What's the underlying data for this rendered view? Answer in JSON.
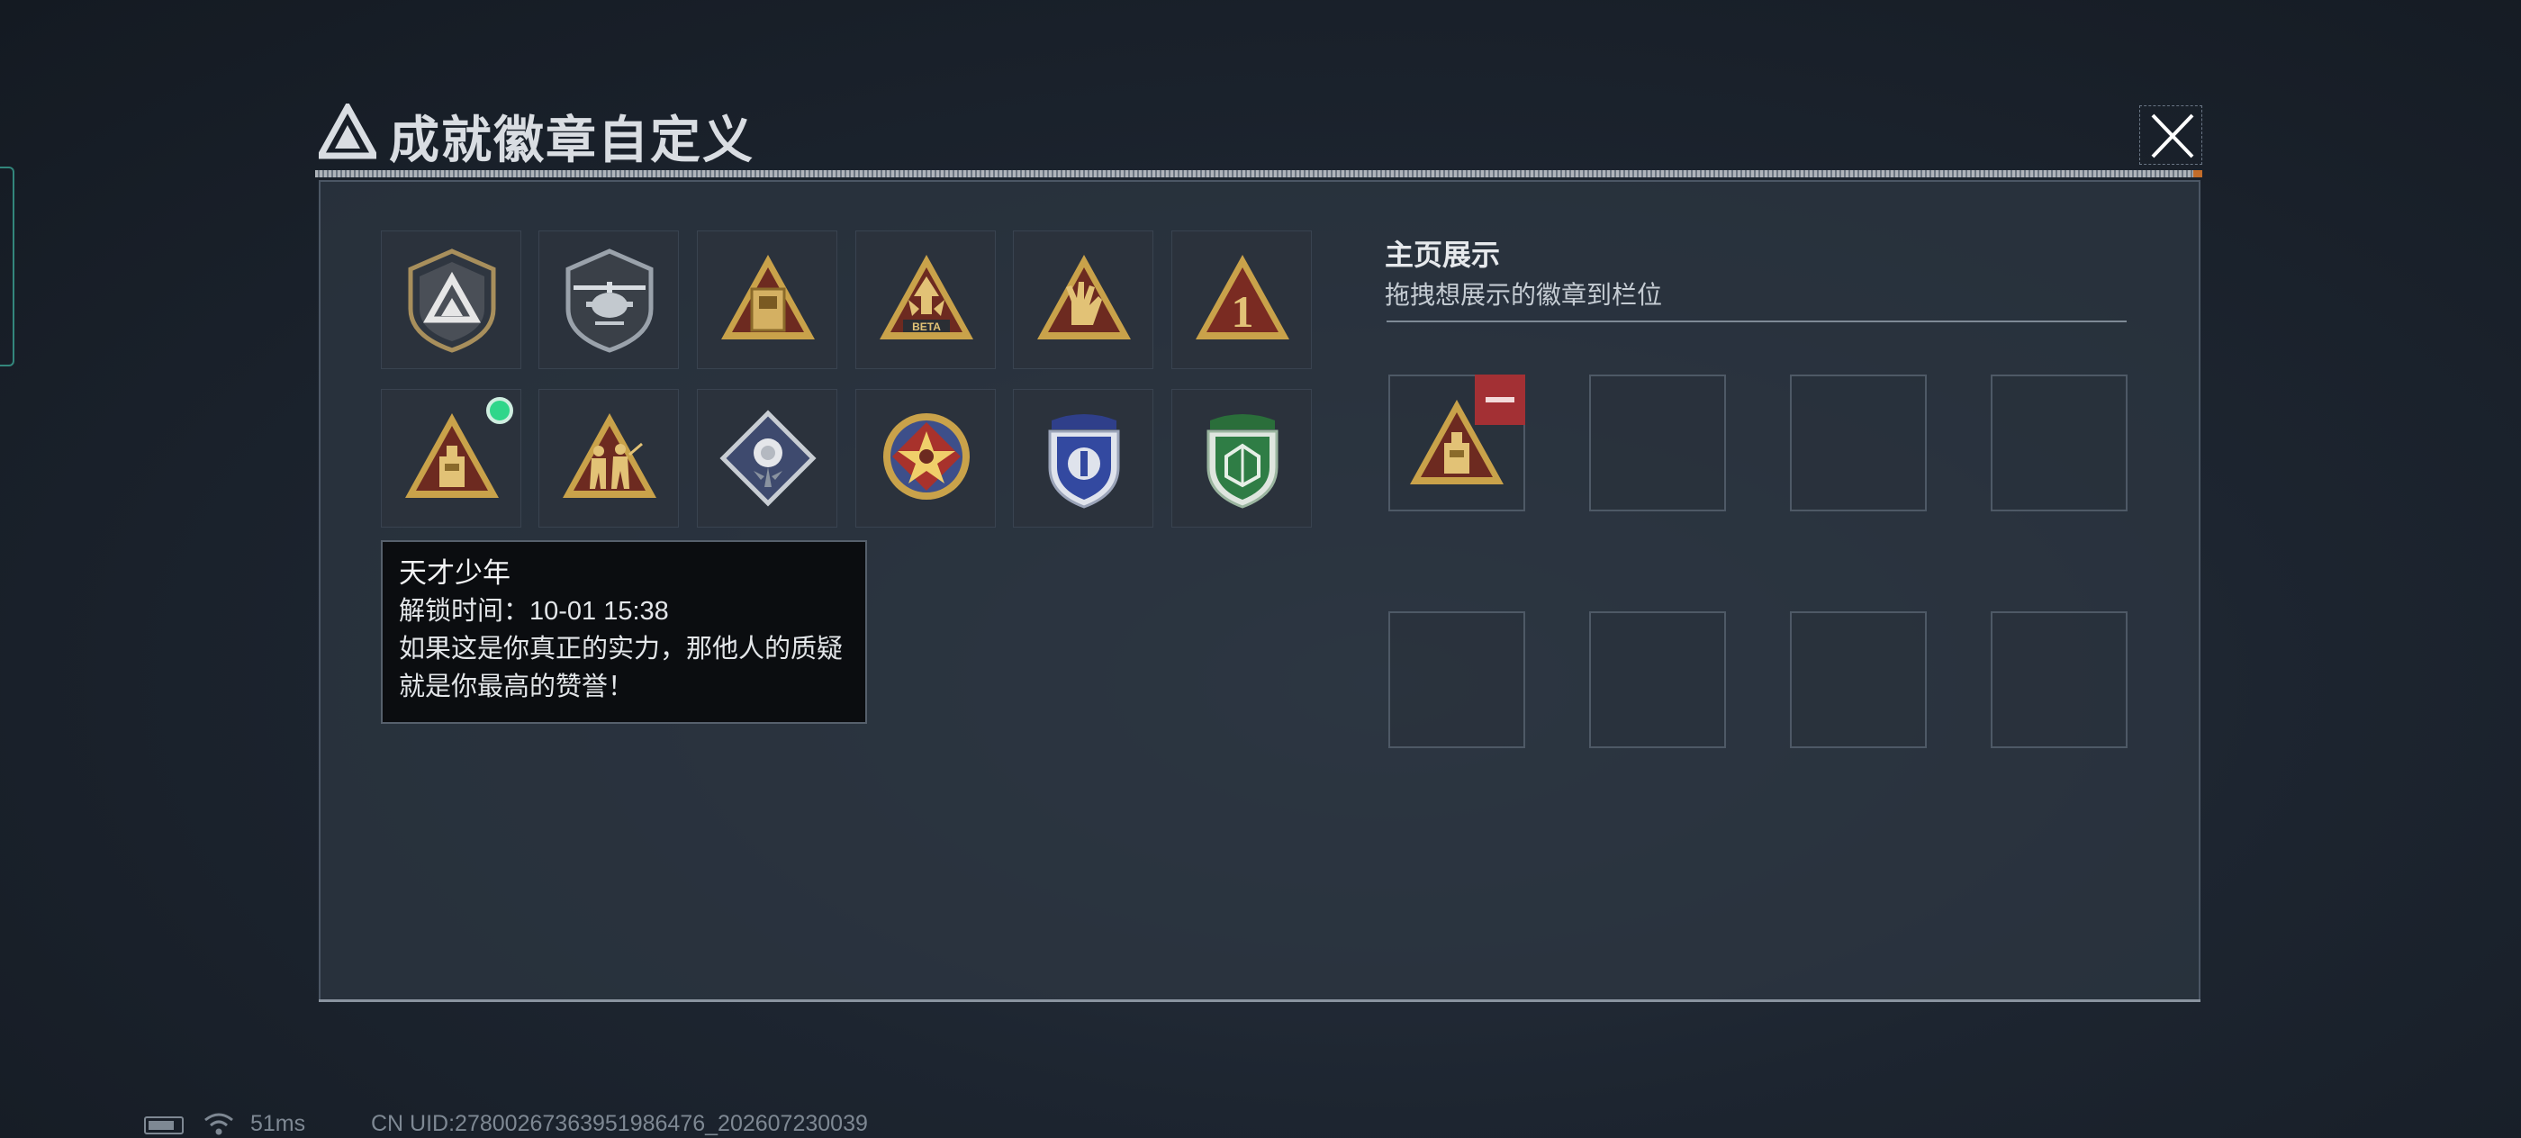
{
  "window": {
    "title": "成就徽章自定义"
  },
  "badges": [
    {
      "name": "shield-a-badge"
    },
    {
      "name": "helicopter-badge"
    },
    {
      "name": "gold-tablet-badge"
    },
    {
      "name": "beta-badge",
      "label": "BETA"
    },
    {
      "name": "hand-sign-badge"
    },
    {
      "name": "number-one-badge",
      "label": "1"
    },
    {
      "name": "prodigy-badge",
      "is_new": true
    },
    {
      "name": "soldiers-badge"
    },
    {
      "name": "rose-badge"
    },
    {
      "name": "star-medal-badge"
    },
    {
      "name": "blue-shield-badge"
    },
    {
      "name": "green-shield-badge"
    }
  ],
  "tooltip": {
    "title": "天才少年",
    "unlock_label": "解锁时间：",
    "unlock_time": "10-01 15:38",
    "description": "如果这是你真正的实力，那他人的质疑就是你最高的赞誉！"
  },
  "showcase": {
    "title": "主页展示",
    "subtitle": "拖拽想展示的徽章到栏位",
    "slots": [
      {
        "badge": "prodigy-badge",
        "removable": true
      },
      {
        "badge": null
      },
      {
        "badge": null
      },
      {
        "badge": null
      },
      {
        "badge": null
      },
      {
        "badge": null
      },
      {
        "badge": null
      },
      {
        "badge": null
      }
    ]
  },
  "status_bar": {
    "ping": "51ms",
    "uid": "CN UID:27800267363951986476_202607230039"
  },
  "colors": {
    "gold": "#c9a24a",
    "badge_red": "#7a2b22",
    "new_dot": "#2fd68a",
    "remove_red": "#a33034"
  }
}
